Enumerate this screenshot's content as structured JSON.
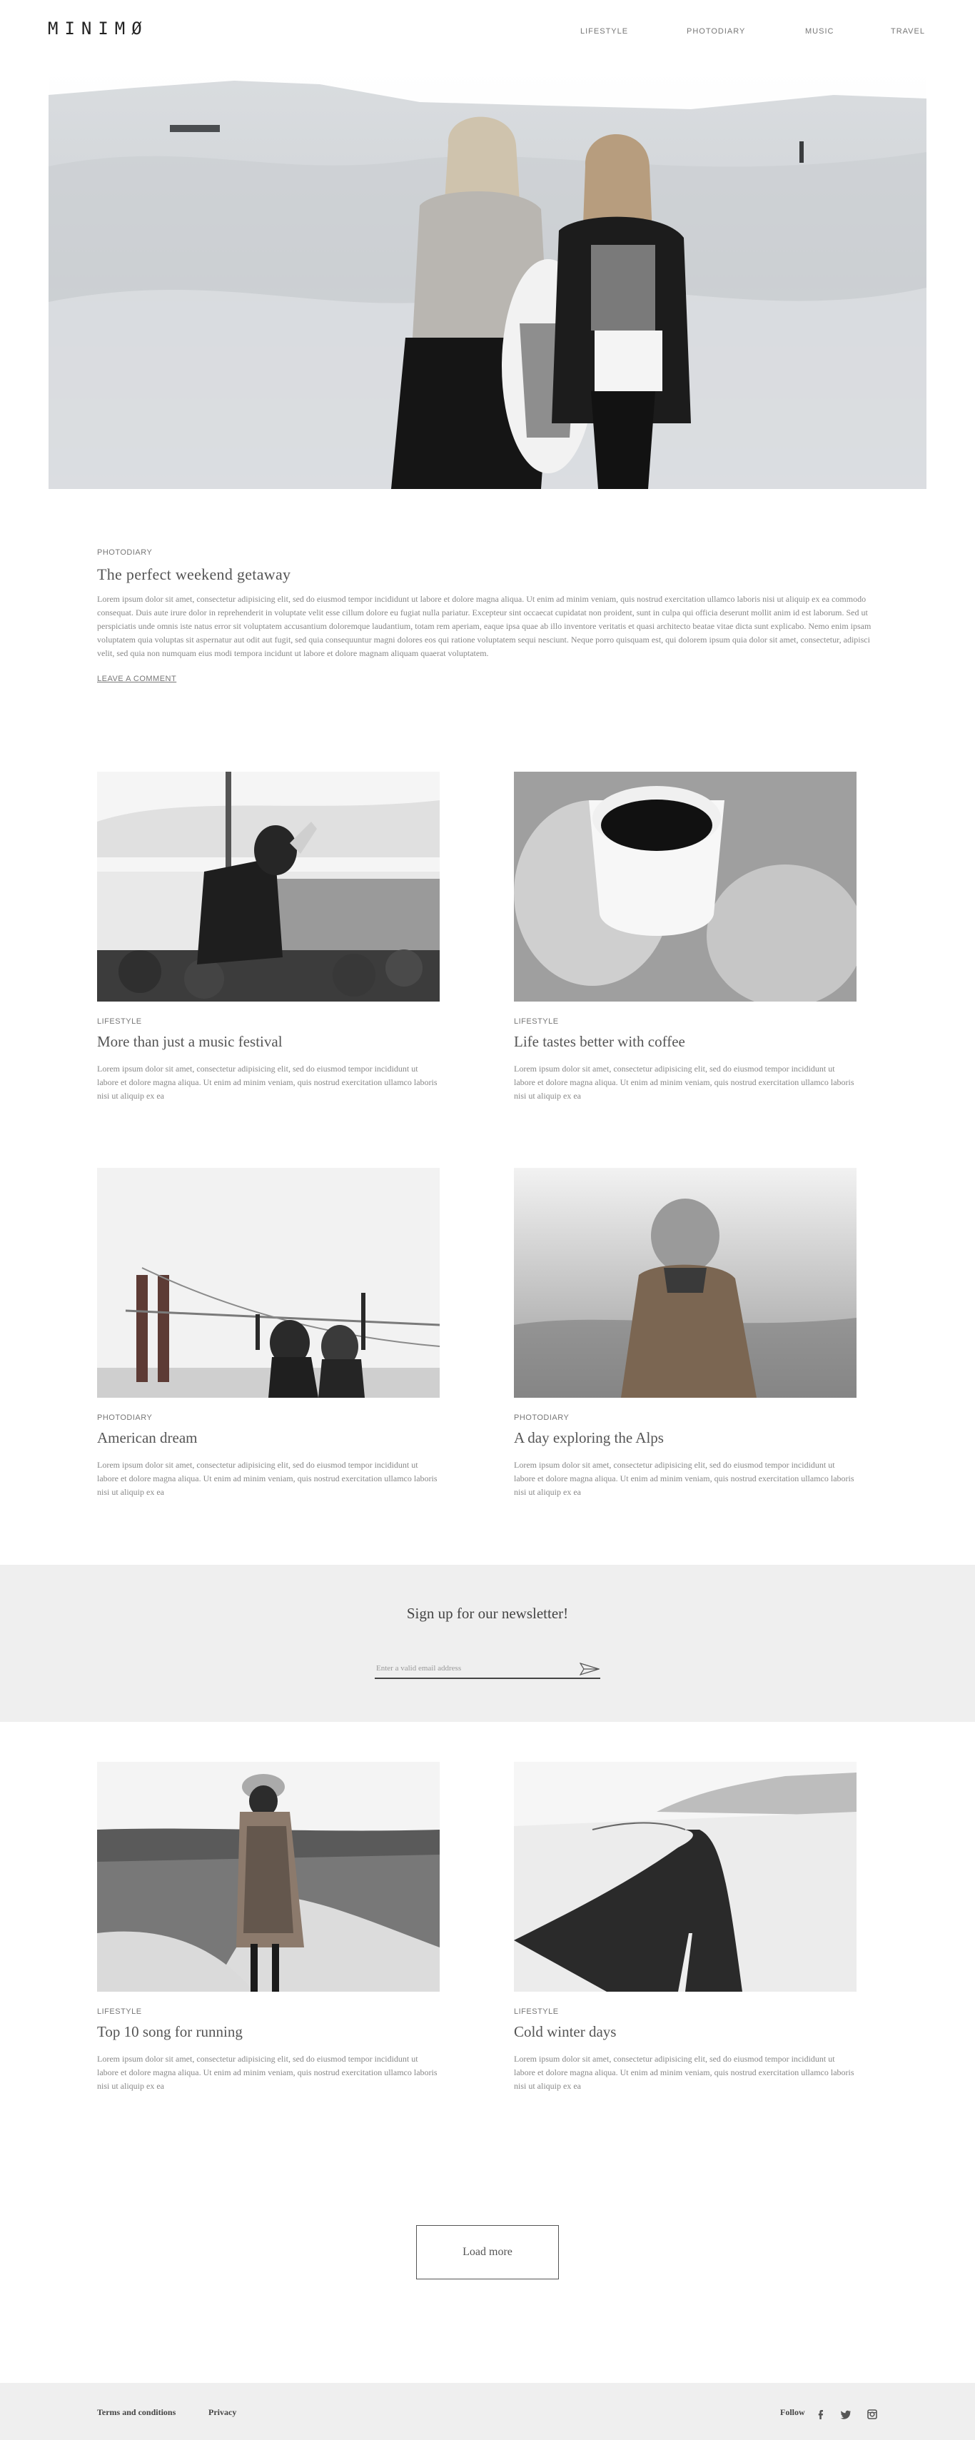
{
  "header": {
    "logo": "MINIMØ",
    "nav": [
      "LIFESTYLE",
      "PHOTODIARY",
      "MUSIC",
      "TRAVEL"
    ]
  },
  "featured": {
    "category": "PHOTODIARY",
    "title": "The perfect weekend getaway",
    "text": "Lorem ipsum dolor sit amet, consectetur adipisicing elit, sed do eiusmod tempor incididunt ut labore et dolore magna aliqua. Ut enim ad minim veniam, quis nostrud exercitation ullamco laboris nisi ut aliquip ex ea commodo consequat. Duis aute irure dolor in reprehenderit in voluptate velit esse cillum dolore eu fugiat nulla pariatur. Excepteur sint occaecat cupidatat non proident, sunt in culpa qui officia deserunt mollit anim id est laborum. Sed ut perspiciatis unde omnis iste natus error sit voluptatem accusantium doloremque laudantium, totam rem aperiam, eaque ipsa quae ab illo inventore veritatis et quasi architecto beatae vitae dicta sunt explicabo. Nemo enim ipsam voluptatem quia voluptas sit aspernatur aut odit aut fugit, sed quia consequuntur magni dolores eos qui ratione voluptatem sequi nesciunt. Neque porro quisquam est, qui dolorem ipsum quia dolor sit amet, consectetur, adipisci velit, sed quia non numquam eius modi tempora incidunt ut labore et dolore magnam aliquam quaerat voluptatem.",
    "comment_link": "LEAVE A COMMENT"
  },
  "posts": [
    {
      "category": "LIFESTYLE",
      "title": "More than just a music festival",
      "text": "Lorem ipsum dolor sit amet, consectetur adipisicing elit, sed do eiusmod tempor incididunt ut labore et dolore magna aliqua. Ut enim ad minim veniam, quis nostrud exercitation ullamco laboris nisi ut aliquip ex ea"
    },
    {
      "category": "LIFESTYLE",
      "title": "Life tastes better with coffee",
      "text": "Lorem ipsum dolor sit amet, consectetur adipisicing elit, sed do eiusmod tempor incididunt ut labore et dolore magna aliqua. Ut enim ad minim veniam, quis nostrud exercitation ullamco laboris nisi ut aliquip ex ea"
    },
    {
      "category": "PHOTODIARY",
      "title": "American dream",
      "text": "Lorem ipsum dolor sit amet, consectetur adipisicing elit, sed do eiusmod tempor incididunt ut labore et dolore magna aliqua. Ut enim ad minim veniam, quis nostrud exercitation ullamco laboris nisi ut aliquip ex ea"
    },
    {
      "category": "PHOTODIARY",
      "title": "A day exploring the Alps",
      "text": "Lorem ipsum dolor sit amet, consectetur adipisicing elit, sed do eiusmod tempor incididunt ut labore et dolore magna aliqua. Ut enim ad minim veniam, quis nostrud exercitation ullamco laboris nisi ut aliquip ex ea"
    },
    {
      "category": "LIFESTYLE",
      "title": "Top 10 song for running",
      "text": "Lorem ipsum dolor sit amet, consectetur adipisicing elit, sed do eiusmod tempor incididunt ut labore et dolore magna aliqua. Ut enim ad minim veniam, quis nostrud exercitation ullamco laboris nisi ut aliquip ex ea"
    },
    {
      "category": "LIFESTYLE",
      "title": "Cold winter days",
      "text": "Lorem ipsum dolor sit amet, consectetur adipisicing elit, sed do eiusmod tempor incididunt ut labore et dolore magna aliqua. Ut enim ad minim veniam, quis nostrud exercitation ullamco laboris nisi ut aliquip ex ea"
    }
  ],
  "newsletter": {
    "title": "Sign up for our newsletter!",
    "placeholder": "Enter a valid email address",
    "send_icon": "paper-plane-icon"
  },
  "load_more": "Load more",
  "footer": {
    "terms": "Terms and conditions",
    "privacy": "Privacy",
    "follow": "Follow",
    "social_icons": [
      "facebook-icon",
      "twitter-icon",
      "instagram-icon"
    ]
  }
}
